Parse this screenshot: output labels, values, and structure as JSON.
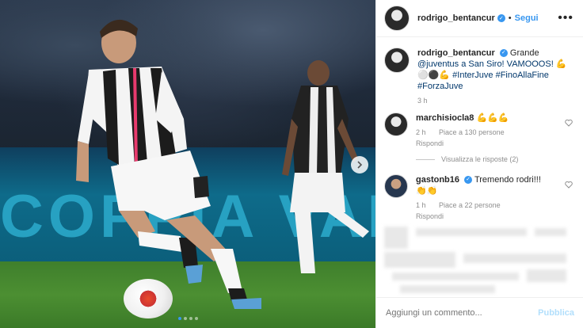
{
  "post": {
    "username": "rodrigo_bentancur",
    "follow_label": "Segui",
    "more_label": "•••",
    "caption_line1": "Grande",
    "caption_line2": "@juventus a San Siro! VAMOOOS!",
    "caption_tags": "#InterJuve #FinoAllaFine",
    "caption_tags2": "#ForzaJuve",
    "caption_time": "3 h",
    "photo_board_text": "COPPIA  VAM"
  },
  "comments": [
    {
      "username": "marchisiocla8",
      "text": "",
      "emojis": "💪💪💪",
      "time": "2 h",
      "likes": "Piace a 130 persone",
      "reply": "Rispondi",
      "view_replies": "Visualizza le risposte (2)"
    },
    {
      "username": "gastonb16",
      "text": "Tremendo rodri!!!",
      "emojis": "👏👏",
      "time": "1 h",
      "likes": "Piace a 22 persone",
      "reply": "Rispondi"
    }
  ],
  "footer": {
    "placeholder": "Aggiungi un commento...",
    "publish": "Pubblica"
  },
  "colors": {
    "accent": "#3897f0",
    "muted": "#8e8e8e",
    "text": "#262626"
  }
}
